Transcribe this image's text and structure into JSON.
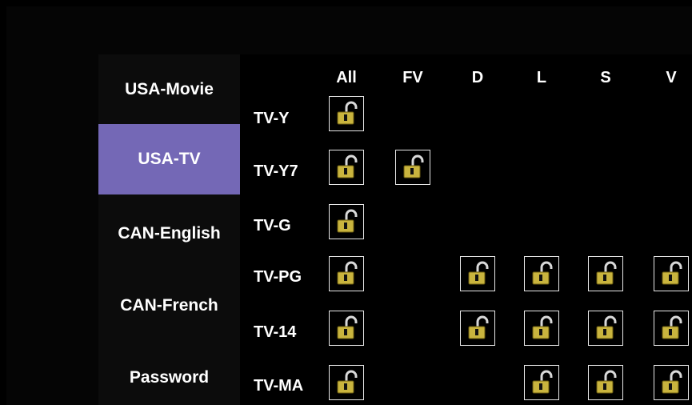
{
  "sidebar": {
    "items": [
      {
        "label": "USA-Movie",
        "selected": false
      },
      {
        "label": "USA-TV",
        "selected": true
      },
      {
        "label": "CAN-English",
        "selected": false
      },
      {
        "label": "CAN-French",
        "selected": false
      },
      {
        "label": "Password",
        "selected": false
      }
    ]
  },
  "ratings_grid": {
    "columns": [
      "All",
      "FV",
      "D",
      "L",
      "S",
      "V"
    ],
    "rows": [
      {
        "label": "TV-Y",
        "cells": [
          "unlocked",
          null,
          null,
          null,
          null,
          null
        ]
      },
      {
        "label": "TV-Y7",
        "cells": [
          "unlocked",
          "unlocked",
          null,
          null,
          null,
          null
        ]
      },
      {
        "label": "TV-G",
        "cells": [
          "unlocked",
          null,
          null,
          null,
          null,
          null
        ]
      },
      {
        "label": "TV-PG",
        "cells": [
          "unlocked",
          null,
          "unlocked",
          "unlocked",
          "unlocked",
          "unlocked"
        ]
      },
      {
        "label": "TV-14",
        "cells": [
          "unlocked",
          null,
          "unlocked",
          "unlocked",
          "unlocked",
          "unlocked"
        ]
      },
      {
        "label": "TV-MA",
        "cells": [
          "unlocked",
          null,
          null,
          "unlocked",
          "unlocked",
          "unlocked"
        ]
      }
    ]
  },
  "icons": {
    "lock_cell": "unlocked-padlock-icon"
  },
  "colors": {
    "selected_bg": "#7468b6",
    "lock_body": "#c9b43e",
    "lock_shackle": "#d9d9d9"
  }
}
